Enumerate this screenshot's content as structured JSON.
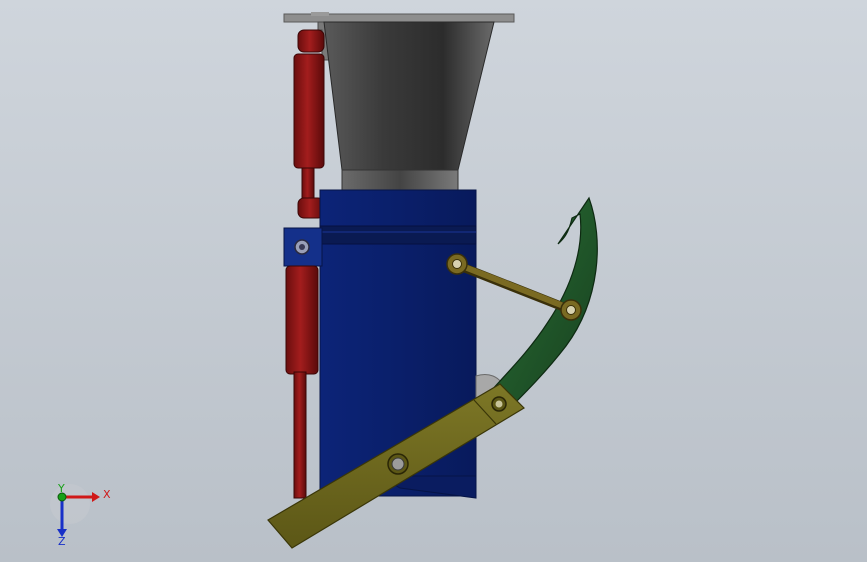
{
  "scene": {
    "background_top": "#cdd3da",
    "background_bottom": "#bcc3cb"
  },
  "model": {
    "hopper_color": "#3b3b3b",
    "housing_color": "#0a1f6e",
    "cylinder_color": "#8a1414",
    "link_color": "#6f6a1e",
    "blade_color": "#1f5a2a",
    "rod_color": "#6b5a1a"
  },
  "triad": {
    "x_label": "X",
    "y_label": "Y",
    "z_label": "Z",
    "x_color": "#d01818",
    "y_color": "#18a018",
    "z_color": "#1830c8"
  }
}
